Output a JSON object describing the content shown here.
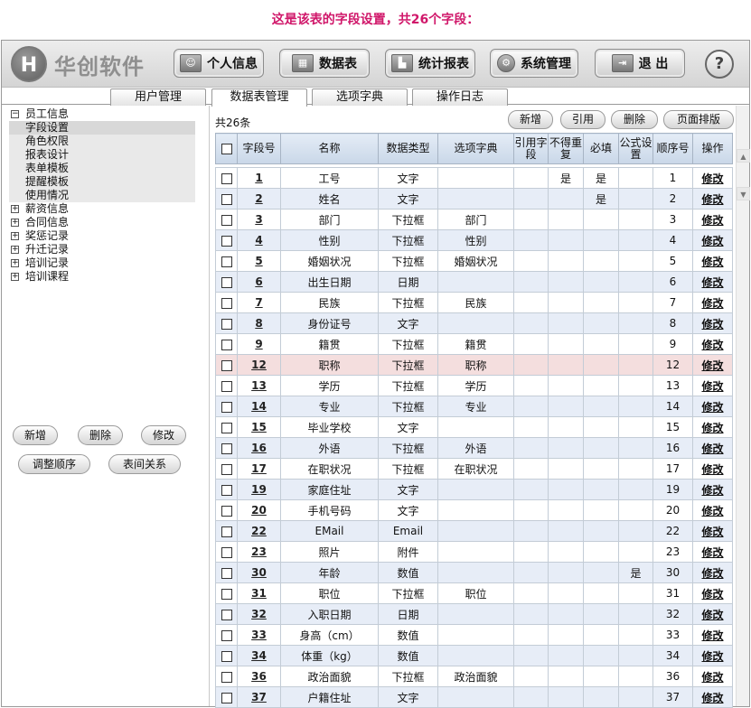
{
  "caption": "这是该表的字段设置，共26个字段：",
  "brand": {
    "name": "华创软件",
    "mark": "H"
  },
  "nav": [
    {
      "label": "个人信息",
      "icon": "person-icon"
    },
    {
      "label": "数据表",
      "icon": "table-icon"
    },
    {
      "label": "统计报表",
      "icon": "chart-icon"
    },
    {
      "label": "系统管理",
      "icon": "gear-icon"
    },
    {
      "label": "退 出",
      "icon": "exit-icon"
    }
  ],
  "help_label": "?",
  "tabs": [
    "用户管理",
    "数据表管理",
    "选项字典",
    "操作日志"
  ],
  "active_tab": "数据表管理",
  "tree": {
    "root": {
      "toggle": "−",
      "label": "员工信息"
    },
    "children": [
      "字段设置",
      "角色权限",
      "报表设计",
      "表单模板",
      "提醒模板",
      "使用情况"
    ],
    "others": [
      {
        "toggle": "+",
        "label": "薪资信息"
      },
      {
        "toggle": "+",
        "label": "合同信息"
      },
      {
        "toggle": "+",
        "label": "奖惩记录"
      },
      {
        "toggle": "+",
        "label": "升迁记录"
      },
      {
        "toggle": "+",
        "label": "培训记录"
      },
      {
        "toggle": "+",
        "label": "培训课程"
      }
    ]
  },
  "left_buttons": {
    "add": "新增",
    "delete": "删除",
    "edit": "修改",
    "reorder": "调整顺序",
    "relation": "表间关系"
  },
  "toolbar": {
    "count": "共26条",
    "add": "新增",
    "reference": "引用",
    "delete": "删除",
    "layout": "页面排版"
  },
  "columns": [
    "字段号",
    "名称",
    "数据类型",
    "选项字典",
    "引用字段",
    "不得重复",
    "必填",
    "公式设置",
    "顺序号",
    "操作"
  ],
  "rows": [
    {
      "id": "1",
      "name": "工号",
      "type": "文字",
      "dict": "",
      "ref": "",
      "unique": "是",
      "required": "是",
      "formula": "",
      "order": "1",
      "action": "修改"
    },
    {
      "id": "2",
      "name": "姓名",
      "type": "文字",
      "dict": "",
      "ref": "",
      "unique": "",
      "required": "是",
      "formula": "",
      "order": "2",
      "action": "修改"
    },
    {
      "id": "3",
      "name": "部门",
      "type": "下拉框",
      "dict": "部门",
      "ref": "",
      "unique": "",
      "required": "",
      "formula": "",
      "order": "3",
      "action": "修改"
    },
    {
      "id": "4",
      "name": "性别",
      "type": "下拉框",
      "dict": "性别",
      "ref": "",
      "unique": "",
      "required": "",
      "formula": "",
      "order": "4",
      "action": "修改"
    },
    {
      "id": "5",
      "name": "婚姻状况",
      "type": "下拉框",
      "dict": "婚姻状况",
      "ref": "",
      "unique": "",
      "required": "",
      "formula": "",
      "order": "5",
      "action": "修改"
    },
    {
      "id": "6",
      "name": "出生日期",
      "type": "日期",
      "dict": "",
      "ref": "",
      "unique": "",
      "required": "",
      "formula": "",
      "order": "6",
      "action": "修改"
    },
    {
      "id": "7",
      "name": "民族",
      "type": "下拉框",
      "dict": "民族",
      "ref": "",
      "unique": "",
      "required": "",
      "formula": "",
      "order": "7",
      "action": "修改"
    },
    {
      "id": "8",
      "name": "身份证号",
      "type": "文字",
      "dict": "",
      "ref": "",
      "unique": "",
      "required": "",
      "formula": "",
      "order": "8",
      "action": "修改"
    },
    {
      "id": "9",
      "name": "籍贯",
      "type": "下拉框",
      "dict": "籍贯",
      "ref": "",
      "unique": "",
      "required": "",
      "formula": "",
      "order": "9",
      "action": "修改"
    },
    {
      "id": "12",
      "name": "职称",
      "type": "下拉框",
      "dict": "职称",
      "ref": "",
      "unique": "",
      "required": "",
      "formula": "",
      "order": "12",
      "action": "修改"
    },
    {
      "id": "13",
      "name": "学历",
      "type": "下拉框",
      "dict": "学历",
      "ref": "",
      "unique": "",
      "required": "",
      "formula": "",
      "order": "13",
      "action": "修改"
    },
    {
      "id": "14",
      "name": "专业",
      "type": "下拉框",
      "dict": "专业",
      "ref": "",
      "unique": "",
      "required": "",
      "formula": "",
      "order": "14",
      "action": "修改"
    },
    {
      "id": "15",
      "name": "毕业学校",
      "type": "文字",
      "dict": "",
      "ref": "",
      "unique": "",
      "required": "",
      "formula": "",
      "order": "15",
      "action": "修改"
    },
    {
      "id": "16",
      "name": "外语",
      "type": "下拉框",
      "dict": "外语",
      "ref": "",
      "unique": "",
      "required": "",
      "formula": "",
      "order": "16",
      "action": "修改"
    },
    {
      "id": "17",
      "name": "在职状况",
      "type": "下拉框",
      "dict": "在职状况",
      "ref": "",
      "unique": "",
      "required": "",
      "formula": "",
      "order": "17",
      "action": "修改"
    },
    {
      "id": "19",
      "name": "家庭住址",
      "type": "文字",
      "dict": "",
      "ref": "",
      "unique": "",
      "required": "",
      "formula": "",
      "order": "19",
      "action": "修改"
    },
    {
      "id": "20",
      "name": "手机号码",
      "type": "文字",
      "dict": "",
      "ref": "",
      "unique": "",
      "required": "",
      "formula": "",
      "order": "20",
      "action": "修改"
    },
    {
      "id": "22",
      "name": "EMail",
      "type": "Email",
      "dict": "",
      "ref": "",
      "unique": "",
      "required": "",
      "formula": "",
      "order": "22",
      "action": "修改"
    },
    {
      "id": "23",
      "name": "照片",
      "type": "附件",
      "dict": "",
      "ref": "",
      "unique": "",
      "required": "",
      "formula": "",
      "order": "23",
      "action": "修改"
    },
    {
      "id": "30",
      "name": "年龄",
      "type": "数值",
      "dict": "",
      "ref": "",
      "unique": "",
      "required": "",
      "formula": "是",
      "order": "30",
      "action": "修改"
    },
    {
      "id": "31",
      "name": "职位",
      "type": "下拉框",
      "dict": "职位",
      "ref": "",
      "unique": "",
      "required": "",
      "formula": "",
      "order": "31",
      "action": "修改"
    },
    {
      "id": "32",
      "name": "入职日期",
      "type": "日期",
      "dict": "",
      "ref": "",
      "unique": "",
      "required": "",
      "formula": "",
      "order": "32",
      "action": "修改"
    },
    {
      "id": "33",
      "name": "身高（cm）",
      "type": "数值",
      "dict": "",
      "ref": "",
      "unique": "",
      "required": "",
      "formula": "",
      "order": "33",
      "action": "修改"
    },
    {
      "id": "34",
      "name": "体重（kg）",
      "type": "数值",
      "dict": "",
      "ref": "",
      "unique": "",
      "required": "",
      "formula": "",
      "order": "34",
      "action": "修改"
    },
    {
      "id": "36",
      "name": "政治面貌",
      "type": "下拉框",
      "dict": "政治面貌",
      "ref": "",
      "unique": "",
      "required": "",
      "formula": "",
      "order": "36",
      "action": "修改"
    },
    {
      "id": "37",
      "name": "户籍住址",
      "type": "文字",
      "dict": "",
      "ref": "",
      "unique": "",
      "required": "",
      "formula": "",
      "order": "37",
      "action": "修改"
    }
  ],
  "highlighted_row_id": "12"
}
